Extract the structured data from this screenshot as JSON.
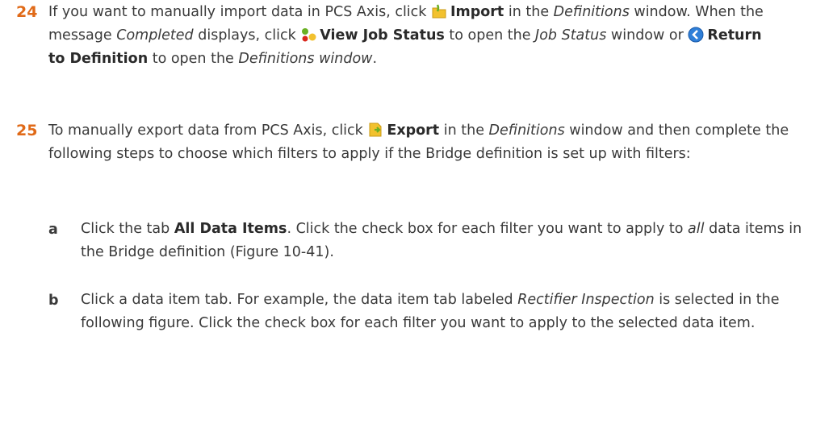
{
  "steps": [
    {
      "number": "24",
      "p1": "If you want to manually import data in PCS Axis, click ",
      "import_label": "Import",
      "p2": " in the ",
      "definitions_em": "Definitions",
      "p3": " window. When the message ",
      "completed_em": "Completed",
      "p4": " displays, click ",
      "view_job_status_label": "View Job Status",
      "p5": " to open the ",
      "job_status_em": "Job Status",
      "p6": " window or ",
      "return_label": "Return to Definition",
      "p7": " to open the ",
      "definitions_window_em": "Definitions window",
      "p8": "."
    },
    {
      "number": "25",
      "p1": "To manually export data from PCS Axis, click ",
      "export_label": "Export",
      "p2": " in the ",
      "definitions_em": "Definitions",
      "p3": " window and then complete the following steps to choose which filters to apply if the Bridge definition is set up with filters:",
      "substeps": [
        {
          "letter": "a",
          "p1": "Click the tab ",
          "tab_label": "All Data Items",
          "p2": ". Click the check box for each filter you want to apply to ",
          "all_em": "all",
          "p3": " data items in the Bridge definition (Figure 10-41)."
        },
        {
          "letter": "b",
          "p1": "Click a data item tab. For example, the data item tab labeled ",
          "rectifier_em": "Rectifier Inspection",
          "p2": " is selected in the following figure. Click the check box for each filter you want to apply to the selected data item."
        }
      ]
    }
  ],
  "icons": {
    "import": "import-folder-icon",
    "view_job_status": "job-status-icon",
    "return": "return-arrow-icon",
    "export": "export-document-icon"
  }
}
